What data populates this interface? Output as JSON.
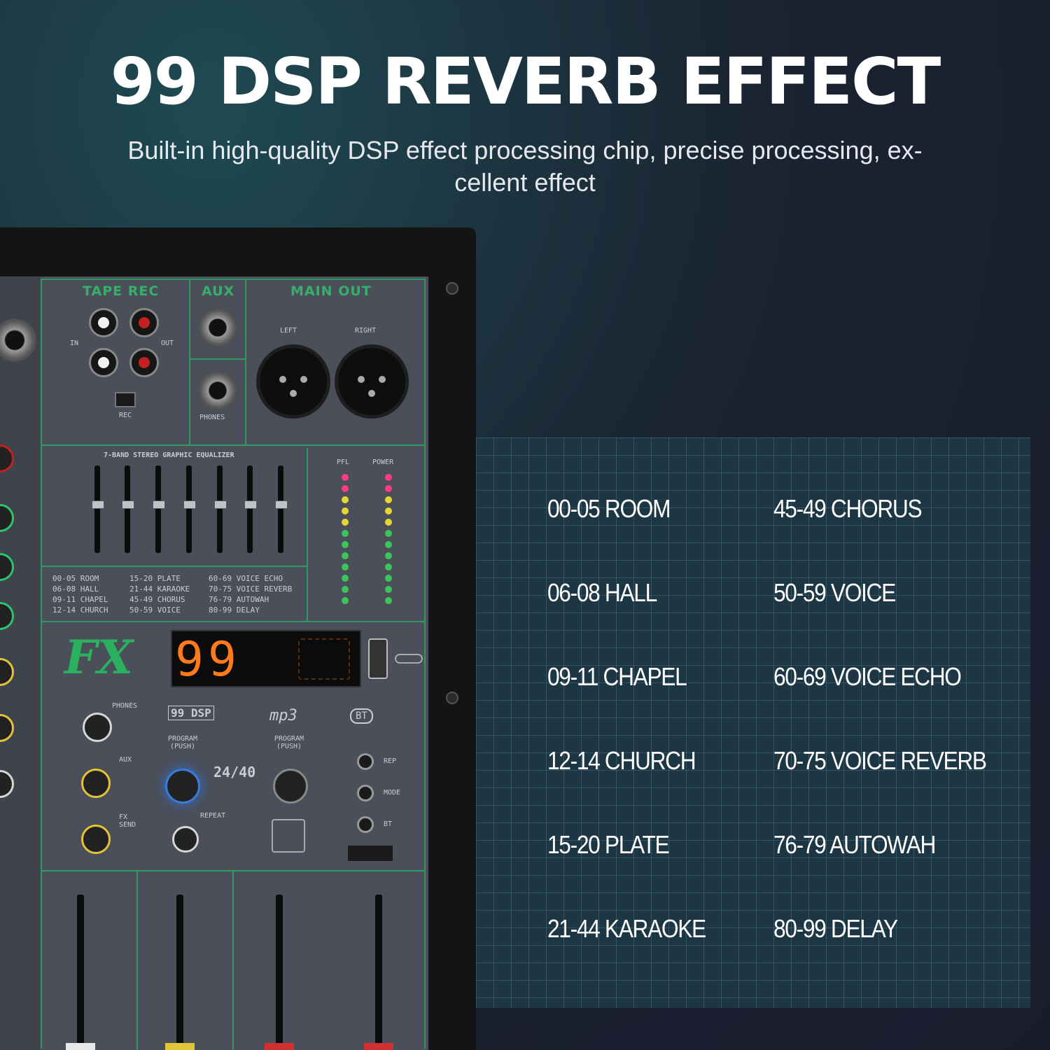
{
  "headline": "99 DSP REVERB EFFECT",
  "subline": "Built-in high-quality DSP effect processing chip, precise processing, ex-cellent effect",
  "mixer": {
    "sections": {
      "tape_rec": "TAPE REC",
      "aux": "AUX",
      "main_out": "MAIN OUT",
      "equalizer": "7-BAND STEREO GRAPHIC EQUALIZER"
    },
    "labels": {
      "in": "IN",
      "out": "OUT",
      "rec": "REC",
      "left": "LEFT",
      "right": "RIGHT",
      "phones": "PHONES",
      "pfl": "PFL",
      "power": "POWER",
      "program_push": "PROGRAM (PUSH)",
      "program_push_2": "PROGRAM (PUSH)",
      "repeat": "REPEAT",
      "aux_knob": "AUX",
      "fx_send": "FX SEND",
      "phones_knob": "PHONES",
      "rep": "REP",
      "mode": "MODE",
      "bt": "BT",
      "dsp_badge": "99 DSP",
      "mp3_badge": "mp3",
      "bt_badge": "BT",
      "bit_badge": "24/40",
      "fx_logo": "FX"
    },
    "display_value": "99",
    "mini_list": [
      "00-05 ROOM",
      "15-20 PLATE",
      "60-69 VOICE ECHO",
      "06-08 HALL",
      "21-44 KARAOKE",
      "70-75 VOICE REVERB",
      "09-11 CHAPEL",
      "45-49 CHORUS",
      "76-79 AUTOWAH",
      "12-14 CHURCH",
      "50-59 VOICE",
      "80-99 DELAY"
    ]
  },
  "effects": [
    "00-05 ROOM",
    "45-49 CHORUS",
    "06-08 HALL",
    "50-59 VOICE",
    "09-11 CHAPEL",
    "60-69 VOICE ECHO",
    "12-14 CHURCH",
    "70-75 VOICE REVERB",
    "15-20 PLATE",
    "76-79 AUTOWAH",
    "21-44 KARAOKE",
    "80-99 DELAY"
  ],
  "colors": {
    "accent_green": "#35b06a",
    "display_orange": "#ff7a1a",
    "table_bg": "#1d3644"
  }
}
